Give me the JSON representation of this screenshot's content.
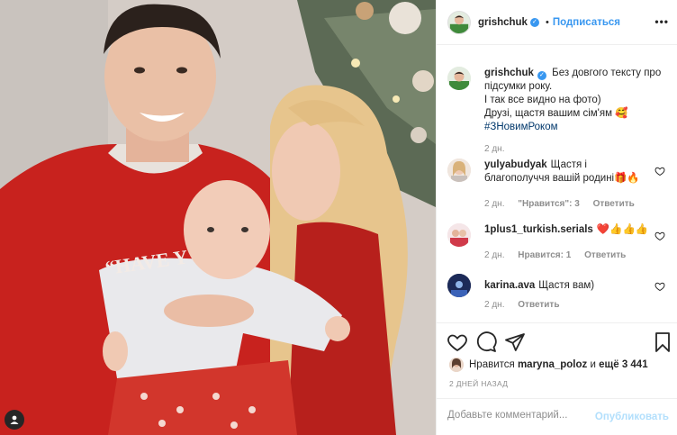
{
  "header": {
    "username": "grishchuk",
    "separator": "•",
    "follow_label": "Подписаться",
    "more_label": "•••"
  },
  "caption": {
    "username": "grishchuk",
    "lines": [
      "Без довгого тексту про",
      "підсумки року.",
      "І так все видно на фото)",
      "Друзі, щастя вашим сім'ям 🥰"
    ],
    "hashtag": "#ЗНовимРоком",
    "time": "2 дн."
  },
  "comments": [
    {
      "username": "yulyabudyak",
      "text": "Щастя і благополуччя вашій родині🎁🔥",
      "time": "2 дн.",
      "likes_label": "\"Нравится\": 3",
      "reply_label": "Ответить"
    },
    {
      "username": "1plus1_turkish.serials",
      "text": "❤️👍👍👍",
      "time": "2 дн.",
      "likes_label": "Нравится: 1",
      "reply_label": "Ответить"
    },
    {
      "username": "karina.ava",
      "text": "Щастя вам)",
      "time": "2 дн.",
      "reply_label": "Ответить"
    }
  ],
  "likes": {
    "prefix": "Нравится",
    "user": "maryna_poloz",
    "middle": "и",
    "count_text": "ещё 3 441"
  },
  "post_date": "2 ДНЕЙ НАЗАД",
  "add_comment": {
    "placeholder": "Добавьте комментарий...",
    "publish_label": "Опубликовать"
  },
  "icons": {
    "heart": "heart-icon",
    "comment": "comment-icon",
    "share": "share-icon",
    "save": "bookmark-icon",
    "verified": "verified-badge-icon",
    "user_tag": "person-icon"
  },
  "colors": {
    "accent": "#3897f0",
    "publish_disabled": "#b2dffc",
    "muted": "#8e8e8e"
  }
}
